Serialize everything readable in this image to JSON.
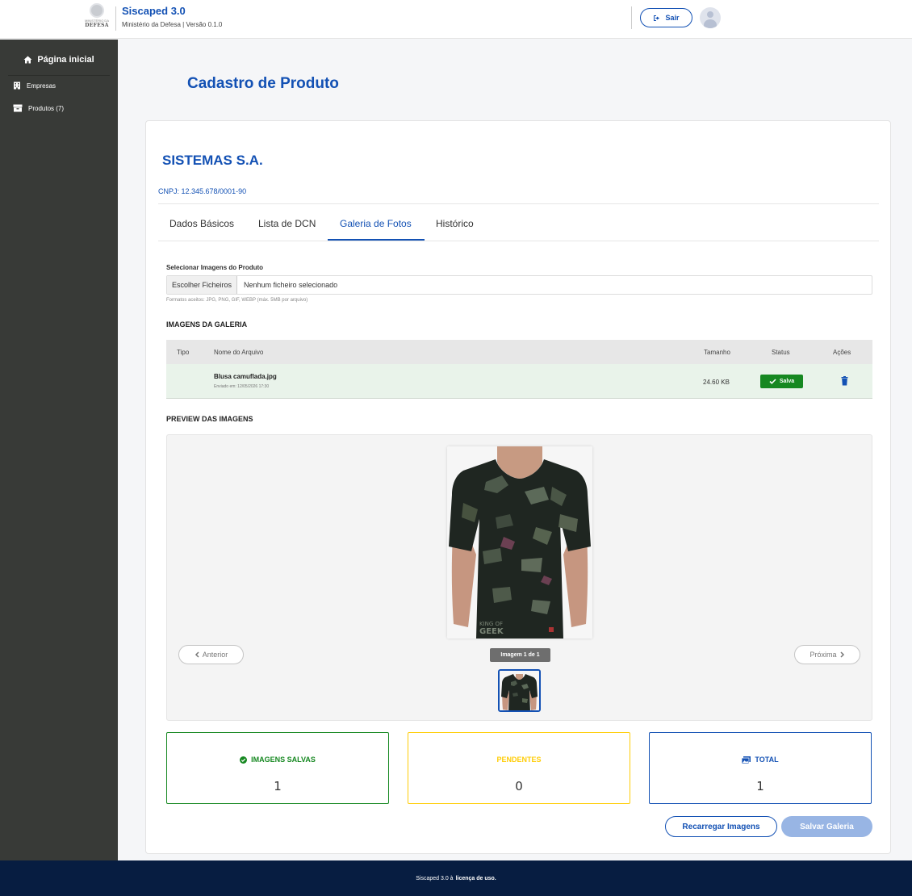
{
  "header": {
    "logo_top": "MINISTÉRIO DA",
    "logo_text": "DEFESA",
    "app_title": "Siscaped 3.0",
    "app_subtitle": "Ministério da Defesa | Versão 0.1.0",
    "logout_label": "Sair"
  },
  "sidebar": {
    "home_label": "Página inicial",
    "items": [
      {
        "label": "Empresas",
        "icon": "building-icon"
      },
      {
        "label": "Produtos (7)",
        "icon": "box-icon"
      }
    ]
  },
  "main": {
    "page_title": "Cadastro de Produto",
    "company_name": "SISTEMAS S.A.",
    "cnpj": "CNPJ: 12.345.678/0001-90",
    "tabs": [
      {
        "label": "Dados Básicos",
        "active": false
      },
      {
        "label": "Lista de DCN",
        "active": false
      },
      {
        "label": "Galeria de Fotos",
        "active": true
      },
      {
        "label": "Histórico",
        "active": false
      }
    ],
    "upload": {
      "label": "Selecionar Imagens do Produto",
      "button_label": "Escolher Ficheiros",
      "file_status": "Nenhum ficheiro selecionado",
      "hint": "Formatos aceitos: JPG, PNG, GIF, WEBP (máx. 5MB por arquivo)"
    },
    "gallery": {
      "title": "IMAGENS DA GALERIA",
      "columns": [
        "Tipo",
        "Nome do Arquivo",
        "Tamanho",
        "Status",
        "Ações"
      ],
      "rows": [
        {
          "type": "",
          "filename": "Blusa camuflada.jpg",
          "sent_at": "Enviado em: 12/05/2026 17:30",
          "size": "24.60 KB",
          "status": "Salva"
        }
      ]
    },
    "preview": {
      "title": "PREVIEW DAS IMAGENS",
      "prev_label": "Anterior",
      "next_label": "Próxima",
      "counter": "Imagem 1 de 1",
      "shirt_print_line1": "KING OF",
      "shirt_print_line2": "GEEK"
    },
    "stats": [
      {
        "label": "IMAGENS SALVAS",
        "value": "1",
        "color": "#168821"
      },
      {
        "label": "PENDENTES",
        "value": "0",
        "color": "#ffcd07"
      },
      {
        "label": "TOTAL",
        "value": "1",
        "color": "#1351b4"
      }
    ],
    "actions": {
      "reload_label": "Recarregar Imagens",
      "save_label": "Salvar Galeria"
    }
  },
  "footer": {
    "text": "Siscaped 3.0 à",
    "link": "licença de uso."
  },
  "colors": {
    "primary": "#1351b4",
    "success": "#168821",
    "warning": "#ffcd07",
    "sidebar_bg": "#383a37",
    "footer_bg": "#071d41"
  }
}
